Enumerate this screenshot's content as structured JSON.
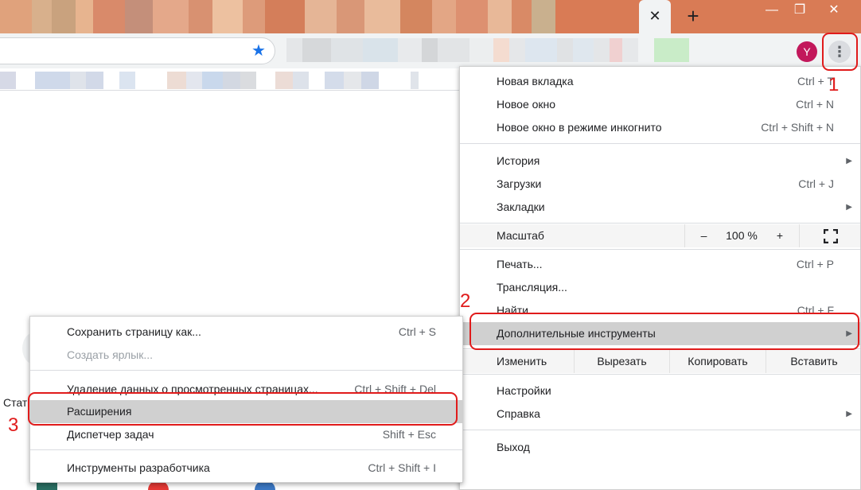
{
  "browser": {
    "tab_close_icon": "close-icon",
    "new_tab_icon": "plus-icon",
    "window_controls": [
      "minimize-icon",
      "restore-icon",
      "close-icon"
    ],
    "avatar_letter": "Y",
    "accent": "#1a73e8",
    "titlebar_color": "#d97b55"
  },
  "main_menu": {
    "items_top": [
      {
        "label": "Новая вкладка",
        "shortcut": "Ctrl + T"
      },
      {
        "label": "Новое окно",
        "shortcut": "Ctrl + N"
      },
      {
        "label": "Новое окно в режиме инкогнито",
        "shortcut": "Ctrl + Shift + N"
      }
    ],
    "history": {
      "label": "История"
    },
    "downloads": {
      "label": "Загрузки",
      "shortcut": "Ctrl + J"
    },
    "bookmarks": {
      "label": "Закладки"
    },
    "zoom": {
      "label": "Масштаб",
      "minus": "–",
      "value": "100 %",
      "plus": "+"
    },
    "print": {
      "label": "Печать...",
      "shortcut": "Ctrl + P"
    },
    "cast": {
      "label": "Трансляция..."
    },
    "find": {
      "label": "Найти",
      "shortcut": "Ctrl + F"
    },
    "more_tools": {
      "label": "Дополнительные инструменты"
    },
    "edit": {
      "label": "Изменить",
      "cut": "Вырезать",
      "copy": "Копировать",
      "paste": "Вставить"
    },
    "settings": {
      "label": "Настройки"
    },
    "help": {
      "label": "Справка"
    },
    "exit": {
      "label": "Выход"
    }
  },
  "sub_menu": {
    "save_page": {
      "label": "Сохранить страницу как...",
      "shortcut": "Ctrl + S"
    },
    "create_shortcut": {
      "label": "Создать ярлык..."
    },
    "clear_data": {
      "label": "Удаление данных о просмотренных страницах...",
      "shortcut": "Ctrl + Shift + Del"
    },
    "extensions": {
      "label": "Расширения"
    },
    "task_manager": {
      "label": "Диспетчер задач",
      "shortcut": "Shift + Esc"
    },
    "dev_tools": {
      "label": "Инструменты разработчика",
      "shortcut": "Ctrl + Shift + I"
    }
  },
  "background": {
    "partial_text": "Стат"
  },
  "annotations": {
    "n1": "1",
    "n2": "2",
    "n3": "3",
    "highlight_color": "#e01b1b"
  }
}
